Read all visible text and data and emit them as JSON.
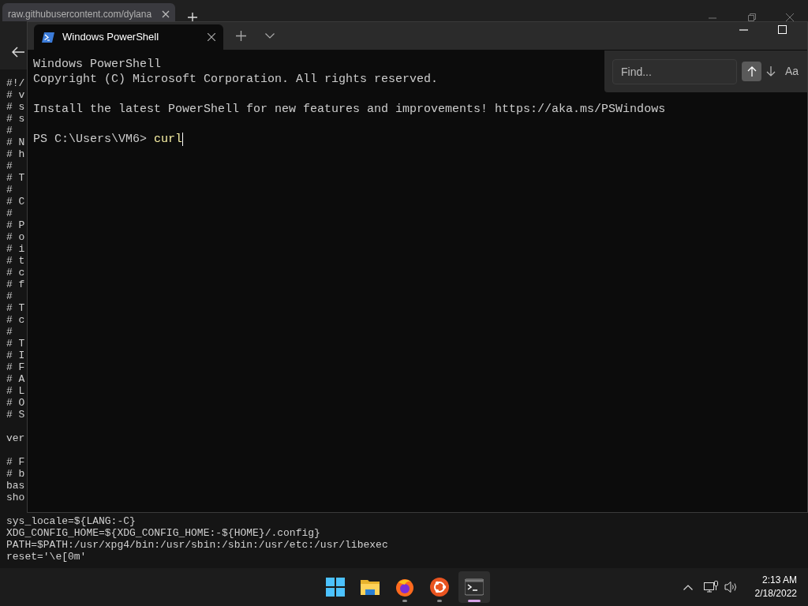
{
  "browser": {
    "tab_title": "raw.githubusercontent.com/dylana",
    "page_lines": [
      {
        "text": "#!/"
      },
      {
        "text": "# v"
      },
      {
        "text": "# s"
      },
      {
        "text": "# s"
      },
      {
        "text": "#"
      },
      {
        "text": "# N"
      },
      {
        "text": "# h"
      },
      {
        "text": "#"
      },
      {
        "text": "# T"
      },
      {
        "text": "#"
      },
      {
        "text": "# C"
      },
      {
        "text": "#"
      },
      {
        "text": "# P"
      },
      {
        "text": "# o"
      },
      {
        "text": "# i"
      },
      {
        "text": "# t"
      },
      {
        "text": "# c"
      },
      {
        "text": "# f"
      },
      {
        "text": "#"
      },
      {
        "text": "# T"
      },
      {
        "text": "# c"
      },
      {
        "text": "#"
      },
      {
        "text": "# T"
      },
      {
        "text": "# I"
      },
      {
        "text": "# F"
      },
      {
        "text": "# A"
      },
      {
        "text": "# L"
      },
      {
        "text": "# O"
      },
      {
        "text": "# S"
      },
      {
        "kind": "blank"
      },
      {
        "text": "ver"
      },
      {
        "kind": "blank"
      },
      {
        "text": "# F"
      },
      {
        "text": "# b"
      },
      {
        "text": "bas"
      },
      {
        "text": "sho"
      },
      {
        "kind": "blank"
      },
      {
        "text": "sys_locale=${LANG:-C}"
      },
      {
        "text": "XDG_CONFIG_HOME=${XDG_CONFIG_HOME:-${HOME}/.config}"
      },
      {
        "text": "PATH=$PATH:/usr/xpg4/bin:/usr/sbin:/sbin:/usr/etc:/usr/libexec"
      },
      {
        "text": "reset='\\e[0m'"
      }
    ]
  },
  "terminal": {
    "tab_title": "Windows PowerShell",
    "lines": [
      {
        "text": "Windows PowerShell"
      },
      {
        "text": "Copyright (C) Microsoft Corporation. All rights reserved."
      },
      {
        "kind": "blank"
      },
      {
        "text": "Install the latest PowerShell for new features and improvements! https://aka.ms/PSWindows"
      },
      {
        "kind": "blank"
      }
    ],
    "prompt": "PS C:\\Users\\VM6>",
    "command": "curl",
    "find": {
      "placeholder": "Find...",
      "case_button": "Aa"
    }
  },
  "taskbar": {
    "apps": [
      {
        "kind": "start",
        "running": false,
        "selected": false
      },
      {
        "kind": "files",
        "running": false,
        "selected": false
      },
      {
        "kind": "firefox",
        "running": true,
        "selected": false
      },
      {
        "kind": "ubuntu",
        "running": true,
        "selected": false
      },
      {
        "kind": "terminal",
        "running": true,
        "selected": true
      }
    ],
    "time": "2:13 AM",
    "date": "2/18/2022"
  }
}
